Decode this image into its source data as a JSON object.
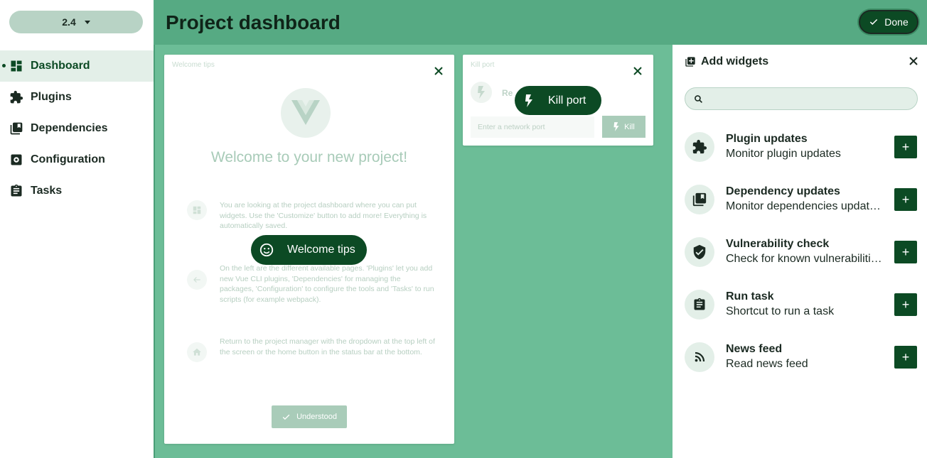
{
  "colors": {
    "accent": "#0c4a24",
    "main_bg": "#6cbd97",
    "topbar_bg": "#56aa83",
    "sidebar_active_bg": "#e3efe8"
  },
  "sidebar": {
    "version": "2.4",
    "items": [
      {
        "label": "Dashboard",
        "icon": "dashboard-icon",
        "active": true
      },
      {
        "label": "Plugins",
        "icon": "puzzle-icon"
      },
      {
        "label": "Dependencies",
        "icon": "library-books-icon"
      },
      {
        "label": "Configuration",
        "icon": "settings-icon"
      },
      {
        "label": "Tasks",
        "icon": "clipboard-icon"
      }
    ]
  },
  "header": {
    "title": "Project dashboard",
    "done_label": "Done"
  },
  "welcome_card": {
    "title": "Welcome tips",
    "heading": "Welcome to your new project!",
    "tips": [
      "You are looking at the project dashboard where you can put widgets. Use the 'Customize' button to add more! Everything is automatically saved.",
      "On the left are the different available pages. 'Plugins' let you add new Vue CLI plugins, 'Dependencies' for managing the packages, 'Configuration' to configure the tools and 'Tasks' to run scripts (for example webpack).",
      "Return to the project manager with the dropdown at the top left of the screen or the home button in the status bar at the bottom."
    ],
    "understood_label": "Understood"
  },
  "killport_card": {
    "title": "Kill port",
    "status": "Re",
    "input_placeholder": "Enter a network port",
    "kill_label": "Kill"
  },
  "tooltips": {
    "welcome": "Welcome tips",
    "kill": "Kill port"
  },
  "panel": {
    "title": "Add widgets",
    "search_value": "",
    "widgets": [
      {
        "title": "Plugin updates",
        "desc": "Monitor plugin updates",
        "icon": "puzzle-icon"
      },
      {
        "title": "Dependency updates",
        "desc": "Monitor dependencies updat…",
        "icon": "library-books-icon"
      },
      {
        "title": "Vulnerability check",
        "desc": "Check for known vulnerabiliti…",
        "icon": "shield-check-icon"
      },
      {
        "title": "Run task",
        "desc": "Shortcut to run a task",
        "icon": "clipboard-icon"
      },
      {
        "title": "News feed",
        "desc": "Read news feed",
        "icon": "rss-icon"
      }
    ],
    "add_label": "+"
  }
}
